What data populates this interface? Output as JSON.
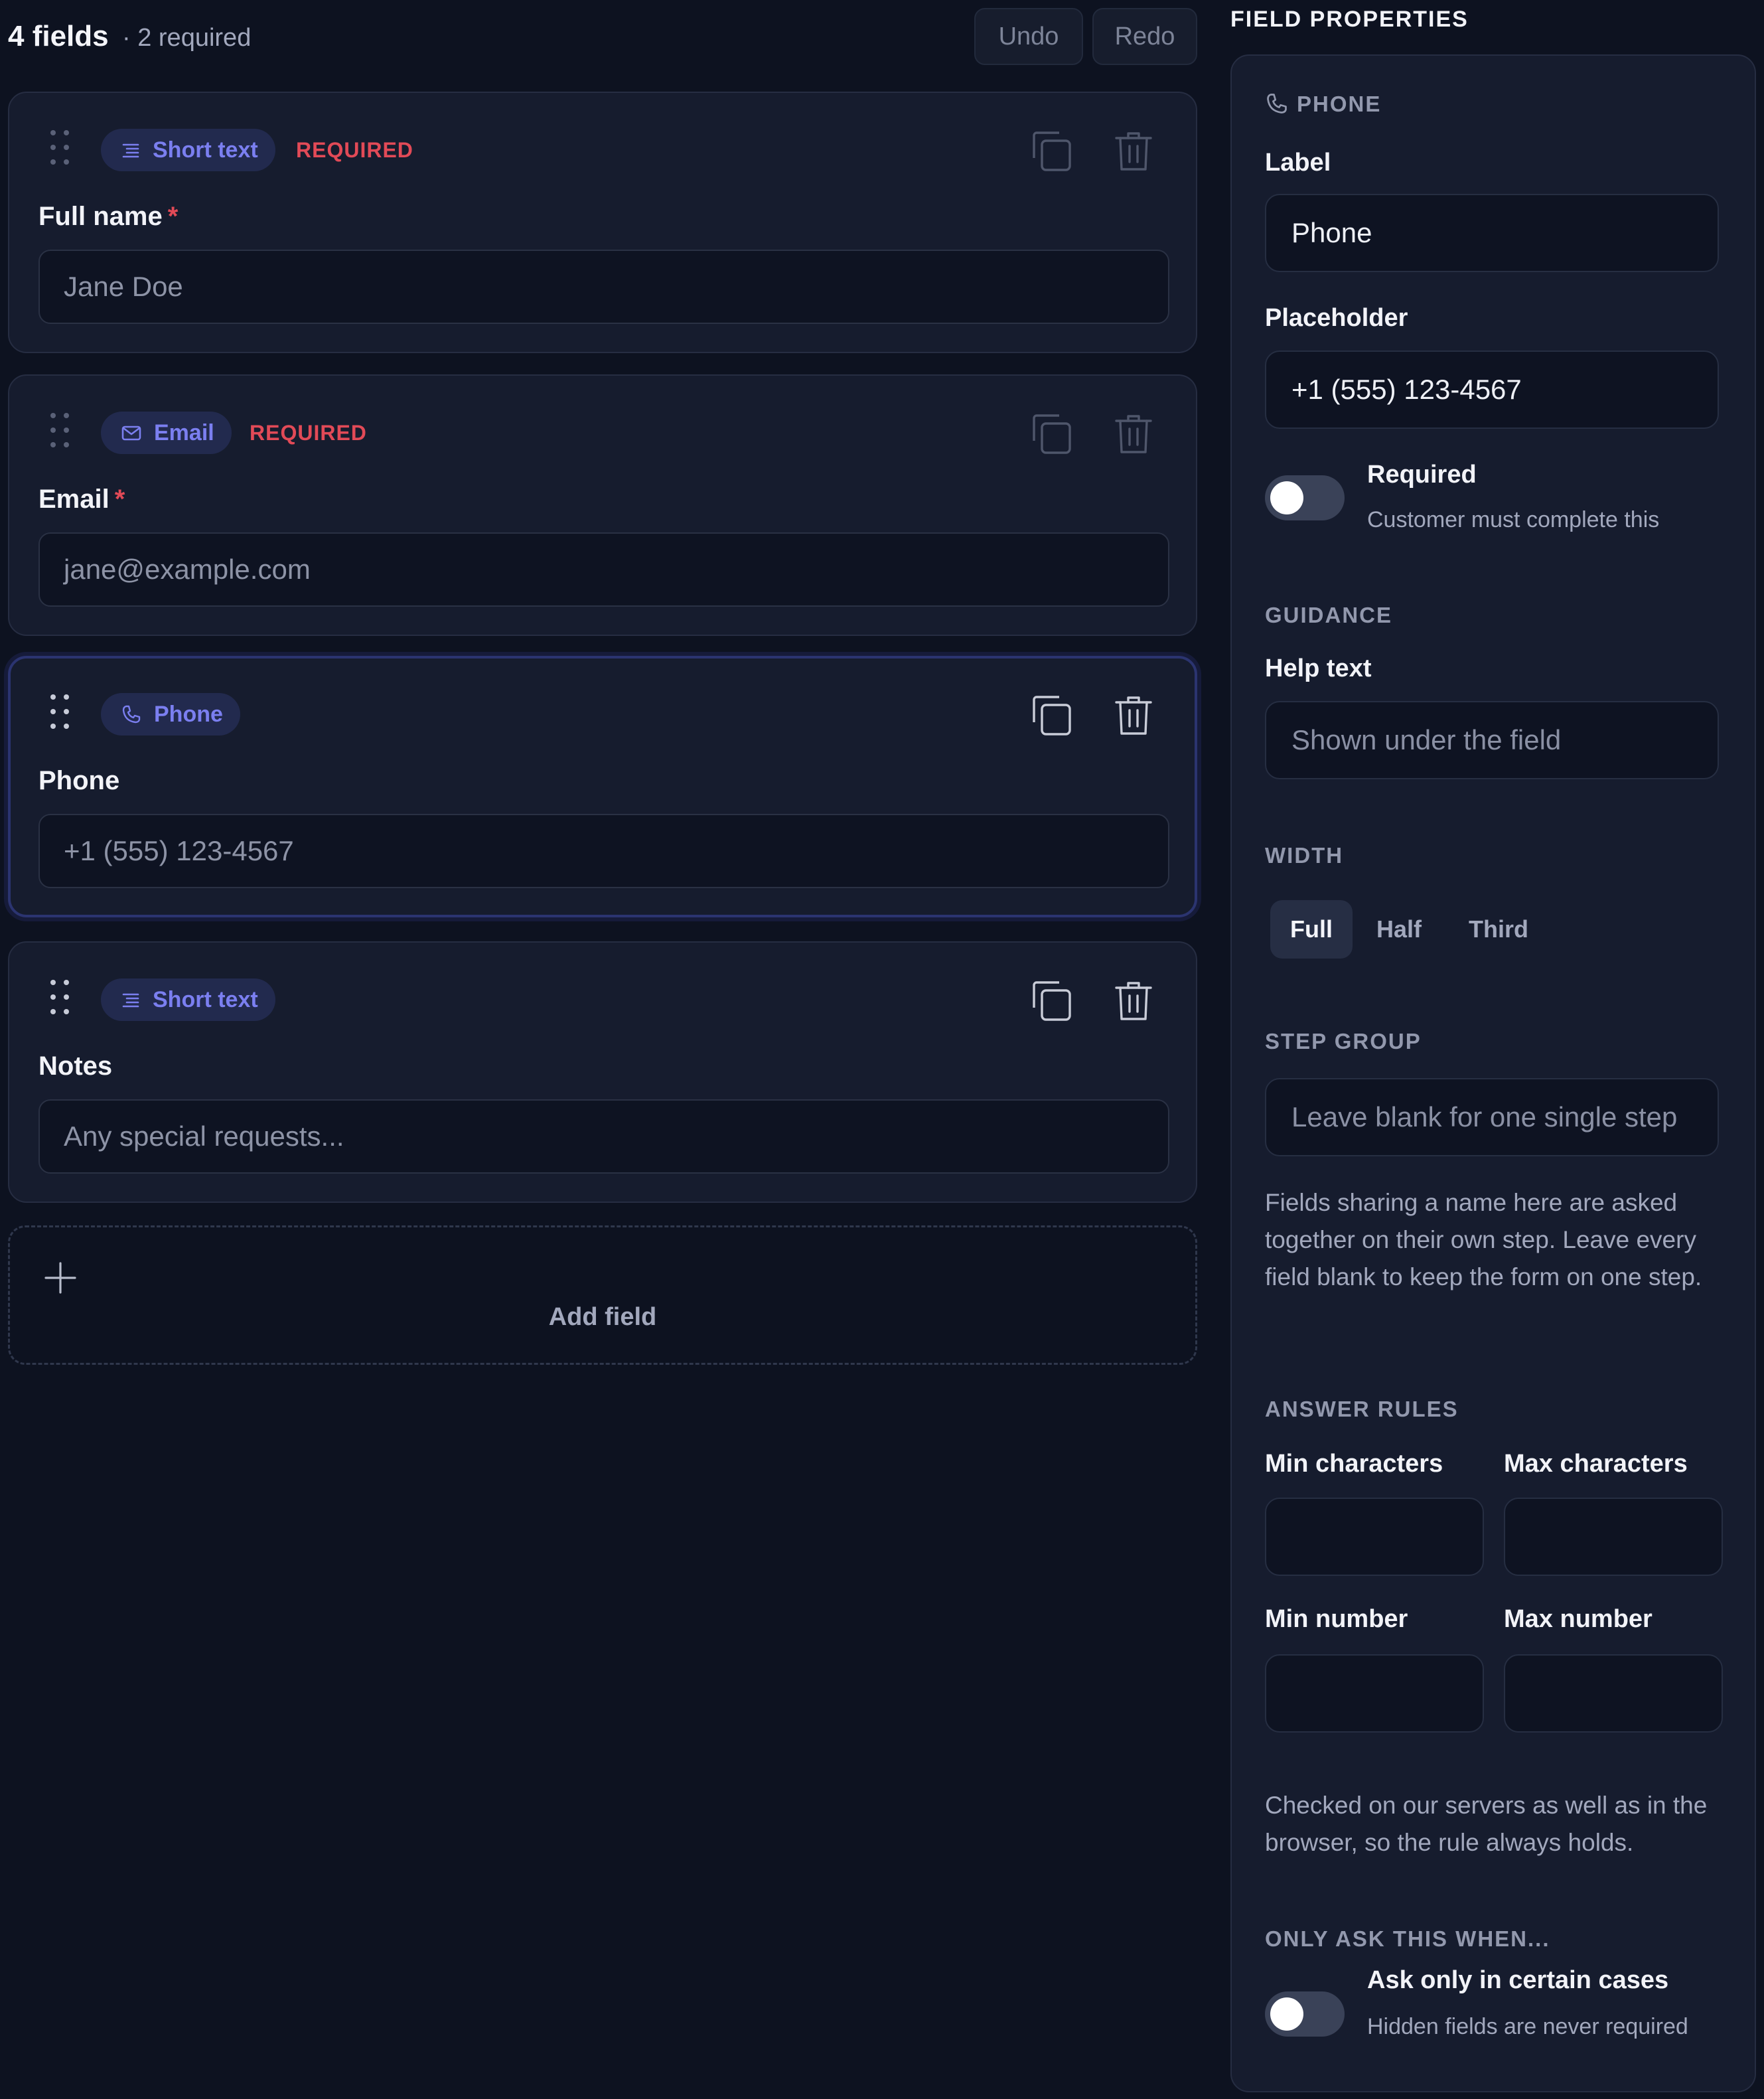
{
  "list": {
    "count_title": "4 fields",
    "count_sub": "· 2 required",
    "undo_label": "Undo",
    "redo_label": "Redo",
    "fields": [
      {
        "type_label": "Short text",
        "type_icon": "short-text-icon",
        "required_badge": "REQUIRED",
        "label": "Full name",
        "required_mark": "*",
        "placeholder": "Jane Doe"
      },
      {
        "type_label": "Email",
        "type_icon": "mail-icon",
        "required_badge": "REQUIRED",
        "label": "Email",
        "required_mark": "*",
        "placeholder": "jane@example.com"
      },
      {
        "type_label": "Phone",
        "type_icon": "phone-icon",
        "label": "Phone",
        "placeholder": "+1 (555) 123-4567",
        "selected": true
      },
      {
        "type_label": "Short text",
        "type_icon": "short-text-icon",
        "label": "Notes",
        "placeholder": "Any special requests..."
      }
    ],
    "add_field_label": "Add field"
  },
  "panel": {
    "title": "FIELD PROPERTIES",
    "field_type": "PHONE",
    "label_label": "Label",
    "label_value": "Phone",
    "placeholder_label": "Placeholder",
    "placeholder_value": "+1 (555) 123-4567",
    "required_title": "Required",
    "required_sub": "Customer must complete this",
    "required_on": false,
    "guidance_section": "GUIDANCE",
    "help_text_label": "Help text",
    "help_text_placeholder": "Shown under the field",
    "width_section": "WIDTH",
    "width_options": [
      "Full",
      "Half",
      "Third"
    ],
    "width_selected": "Full",
    "step_group_section": "STEP GROUP",
    "step_group_placeholder": "Leave blank for one single step",
    "step_group_help": "Fields sharing a name here are asked together on their own step. Leave every field blank to keep the form on one step.",
    "answer_rules_section": "ANSWER RULES",
    "min_chars_label": "Min characters",
    "max_chars_label": "Max characters",
    "min_number_label": "Min number",
    "max_number_label": "Max number",
    "rules_help": "Checked on our servers as well as in the browser, so the rule always holds.",
    "conditional_section": "ONLY ASK THIS WHEN...",
    "conditional_title": "Ask only in certain cases",
    "conditional_sub": "Hidden fields are never required",
    "conditional_on": false
  },
  "colors": {
    "background": "#0d1220",
    "card": "#161c2e",
    "accent": "#7b7ff0",
    "required": "#e24a57"
  }
}
